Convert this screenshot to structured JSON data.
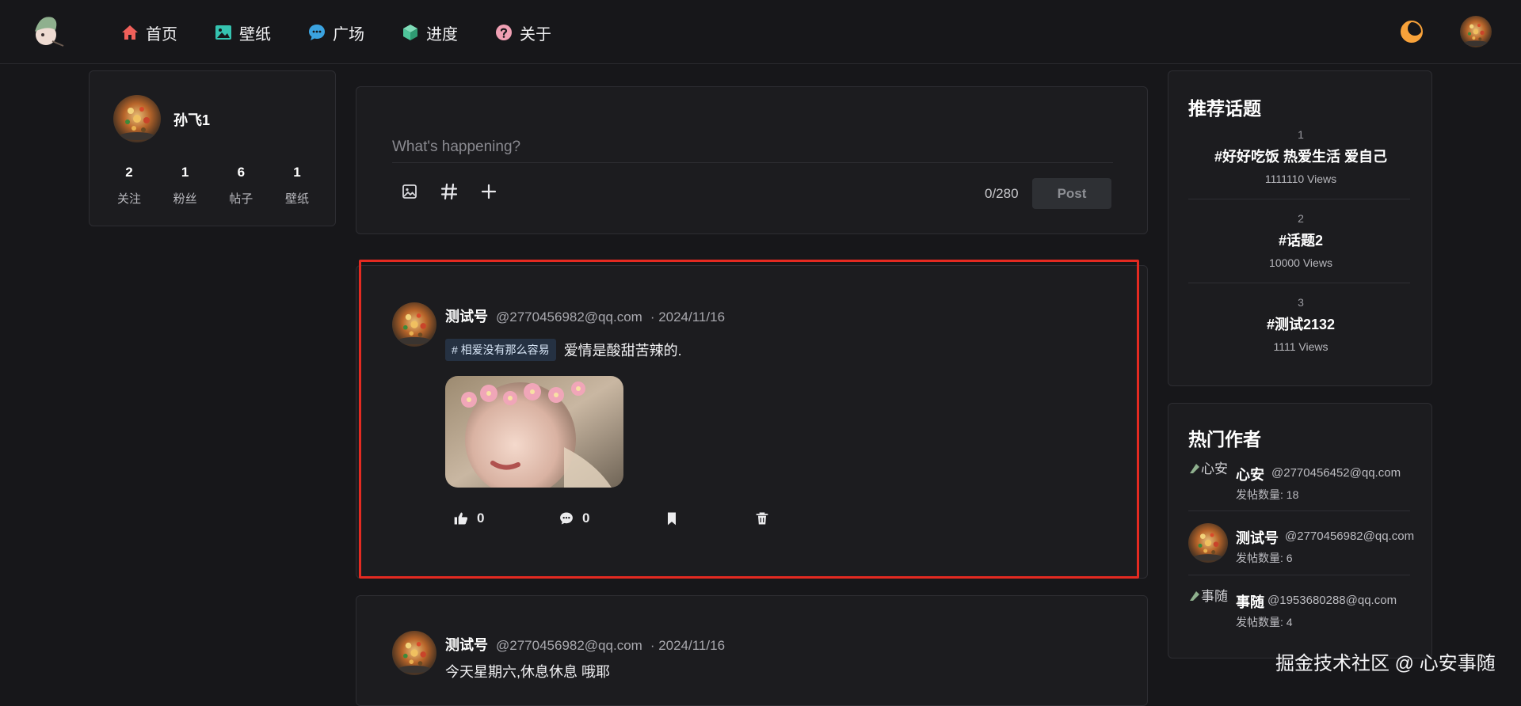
{
  "nav": {
    "items": [
      {
        "label": "首页",
        "icon": "home-icon",
        "color": "#f0605a"
      },
      {
        "label": "壁纸",
        "icon": "image-icon",
        "color": "#35c3b0"
      },
      {
        "label": "广场",
        "icon": "chat-icon",
        "color": "#3ba3e0"
      },
      {
        "label": "进度",
        "icon": "cube-icon",
        "color": "#4ec59a"
      },
      {
        "label": "关于",
        "icon": "question-icon",
        "color": "#f0a0b4"
      }
    ],
    "theme_icon": "moon-icon",
    "theme_color": "#f8a23a"
  },
  "profile": {
    "name": "孙飞1",
    "stats": [
      {
        "value": "2",
        "label": "关注"
      },
      {
        "value": "1",
        "label": "粉丝"
      },
      {
        "value": "6",
        "label": "帖子"
      },
      {
        "value": "1",
        "label": "壁纸"
      }
    ]
  },
  "composer": {
    "placeholder": "What's happening?",
    "counter": "0/280",
    "post_label": "Post"
  },
  "posts": [
    {
      "author": "测试号",
      "handle": "@2770456982@qq.com",
      "date": "· 2024/11/16",
      "tag": "# 相爱没有那么容易",
      "text": "爱情是酸甜苦辣的.",
      "likes": "0",
      "comments": "0"
    },
    {
      "author": "测试号",
      "handle": "@2770456982@qq.com",
      "date": "· 2024/11/16",
      "text": "今天星期六,休息休息 哦耶"
    }
  ],
  "topics": {
    "title": "推荐话题",
    "items": [
      {
        "rank": "1",
        "name": "#好好吃饭 热爱生活 爱自己",
        "views": "1111110 Views"
      },
      {
        "rank": "2",
        "name": "#话题2",
        "views": "10000 Views"
      },
      {
        "rank": "3",
        "name": "#测试2132",
        "views": "1111 Views"
      }
    ]
  },
  "authors": {
    "title": "热门作者",
    "items": [
      {
        "name": "心安",
        "email": "@2770456452@qq.com",
        "count": "发帖数量: 18",
        "alt": "心安",
        "broken": true
      },
      {
        "name": "测试号",
        "email": "@2770456982@qq.com",
        "count": "发帖数量: 6",
        "broken": false
      },
      {
        "name": "事随",
        "email": "@1953680288@qq.com",
        "count": "发帖数量: 4",
        "alt": "事随",
        "broken": true
      }
    ]
  },
  "watermark": "掘金技术社区 @ 心安事随",
  "colors": {
    "bg": "#17171a",
    "card": "#1c1c1f",
    "highlight": "#e42a21",
    "tag_bg": "#253142"
  }
}
